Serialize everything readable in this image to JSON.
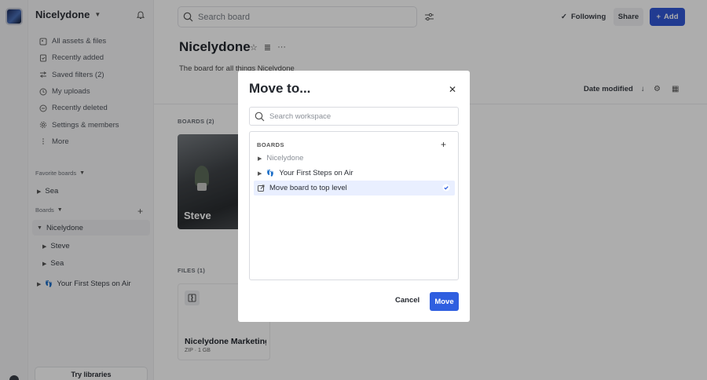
{
  "workspace": {
    "name": "Nicelydone"
  },
  "sidebar": {
    "nav": [
      {
        "label": "All assets & files",
        "icon": "assets-icon"
      },
      {
        "label": "Recently added",
        "icon": "recent-added-icon"
      },
      {
        "label": "Saved filters (2)",
        "icon": "saved-filters-icon"
      },
      {
        "label": "My uploads",
        "icon": "uploads-icon"
      },
      {
        "label": "Recently deleted",
        "icon": "trash-icon"
      },
      {
        "label": "Settings & members",
        "icon": "gear-icon"
      },
      {
        "label": "More",
        "icon": "more-vertical-icon"
      }
    ],
    "favorites_label": "Favorite boards",
    "favorites": [
      {
        "label": "Sea"
      }
    ],
    "boards_label": "Boards",
    "tree": [
      {
        "label": "Nicelydone"
      },
      {
        "label": "Steve"
      },
      {
        "label": "Sea"
      },
      {
        "label": "Your First Steps on Air"
      }
    ],
    "try_libraries": "Try libraries"
  },
  "topbar": {
    "search_placeholder": "Search board",
    "following": "Following",
    "share": "Share",
    "add": "Add"
  },
  "board": {
    "title": "Nicelydone",
    "description": "The board for all things Nicelydone",
    "sort_label": "Date modified",
    "boards_section": "BOARDS (2)",
    "board_cards": [
      {
        "label": "Steve"
      }
    ],
    "files_section": "FILES (1)",
    "files": [
      {
        "name": "Nicelydone Marketing",
        "meta": "ZIP · 1 GB"
      }
    ]
  },
  "modal": {
    "title": "Move to...",
    "search_placeholder": "Search workspace",
    "boards_heading": "BOARDS",
    "rows": [
      {
        "label": "Nicelydone",
        "state": "disabled"
      },
      {
        "label": "Your First Steps on Air",
        "state": "normal"
      },
      {
        "label": "Move board to top level",
        "state": "selected"
      }
    ],
    "cancel": "Cancel",
    "move": "Move"
  },
  "colors": {
    "accent": "#2f5fe0",
    "selected_row": "#e9efff"
  }
}
